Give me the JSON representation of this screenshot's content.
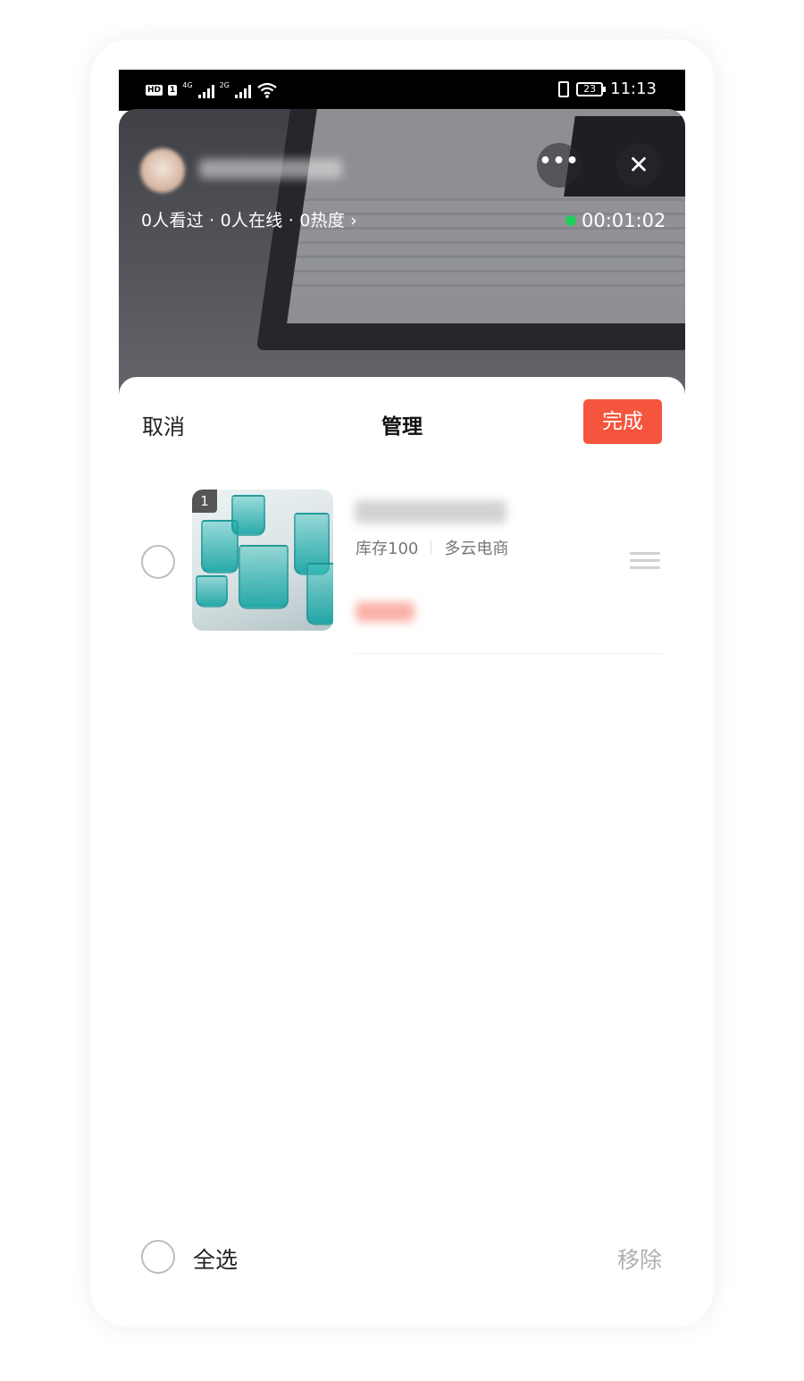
{
  "status_bar": {
    "left": {
      "hd_label": "HD",
      "sim1": "1",
      "net1": "4G",
      "net2": "2G"
    },
    "right": {
      "battery": "23",
      "time": "11:13"
    }
  },
  "live": {
    "stats": "0人看过 · 0人在线 · 0热度 ›",
    "timer": "00:01:02",
    "live_dot_color": "#1fcf5b",
    "more_icon": "more-dots-icon",
    "close_icon": "close-icon"
  },
  "sheet": {
    "cancel_label": "取消",
    "title": "管理",
    "done_label": "完成",
    "done_color": "#f5553d"
  },
  "products": [
    {
      "index": "1",
      "stock": "库存100",
      "shop": "多云电商",
      "selected": false
    }
  ],
  "footer": {
    "select_all_label": "全选",
    "remove_label": "移除"
  }
}
